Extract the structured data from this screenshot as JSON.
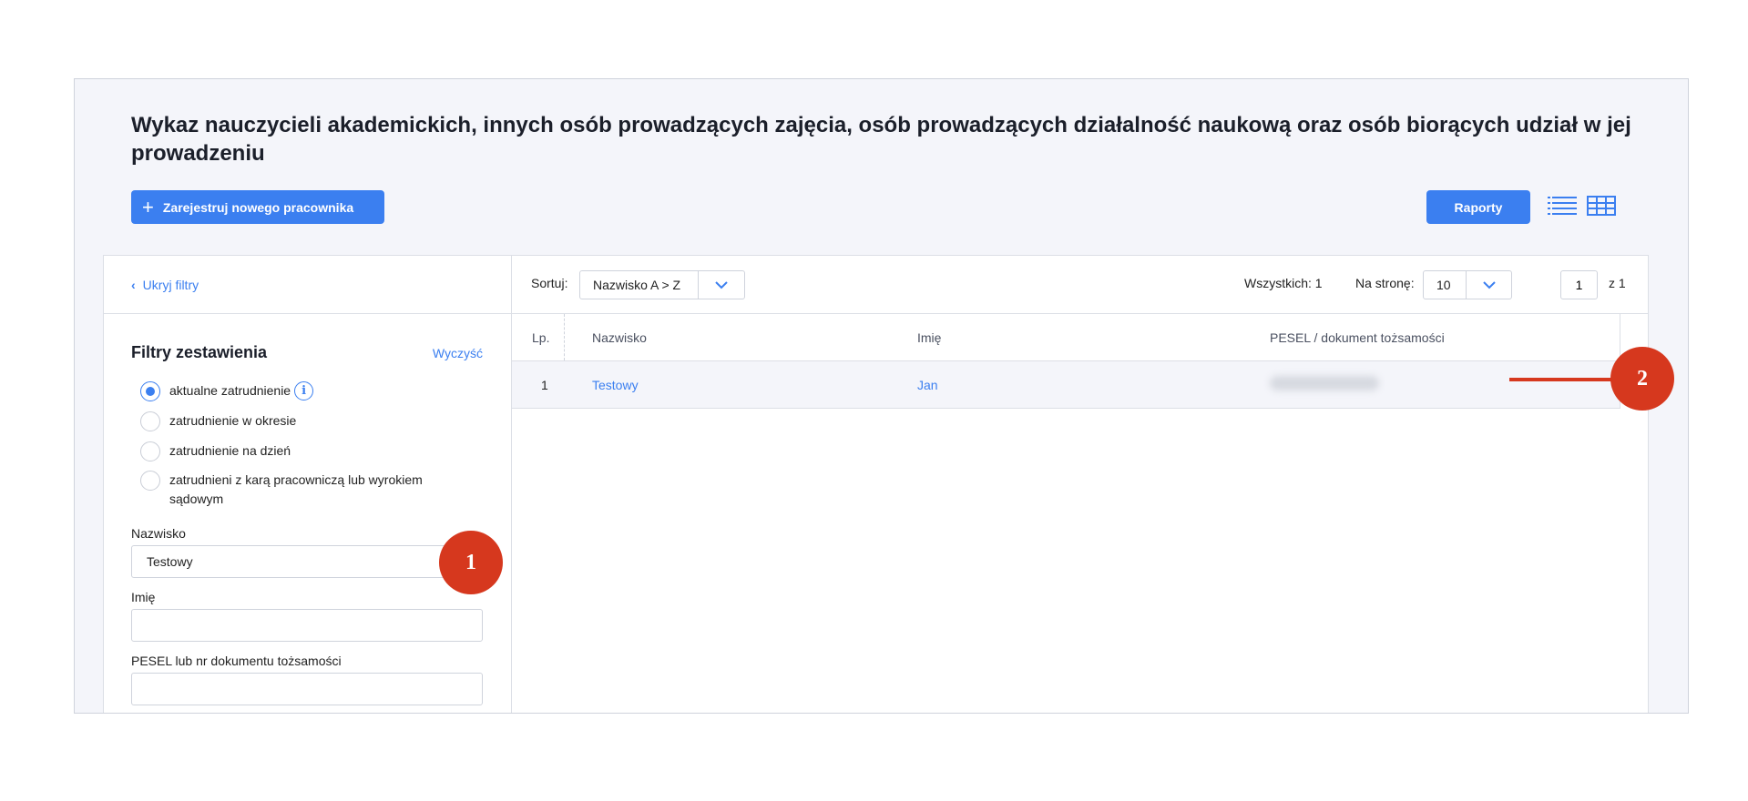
{
  "header": {
    "title": "Wykaz nauczycieli akademickich, innych osób prowadzących zajęcia, osób prowadzących działalność naukową oraz osób biorących udział w jej prowadzeniu",
    "register_button": "Zarejestruj nowego pracownika",
    "reports_button": "Raporty"
  },
  "sidebar": {
    "hide_filters": "Ukryj filtry",
    "filters_title": "Filtry zestawienia",
    "clear": "Wyczyść",
    "radios": [
      {
        "label": "aktualne zatrudnienie",
        "checked": true
      },
      {
        "label": "zatrudnienie w okresie",
        "checked": false
      },
      {
        "label": "zatrudnienie na dzień",
        "checked": false
      },
      {
        "label": "zatrudnieni z karą pracowniczą lub wyrokiem sądowym",
        "checked": false
      }
    ],
    "fields": {
      "surname_label": "Nazwisko",
      "surname_value": "Testowy",
      "firstname_label": "Imię",
      "firstname_value": "",
      "pesel_label": "PESEL lub nr dokumentu tożsamości",
      "pesel_value": ""
    }
  },
  "toolbar": {
    "sort_label": "Sortuj:",
    "sort_value": "Nazwisko A > Z",
    "total": "Wszystkich: 1",
    "per_page_label": "Na stronę:",
    "per_page_value": "10",
    "page_current": "1",
    "page_of": "z  1"
  },
  "table": {
    "headers": {
      "lp": "Lp.",
      "surname": "Nazwisko",
      "firstname": "Imię",
      "pesel": "PESEL / dokument tożsamości"
    },
    "rows": [
      {
        "lp": "1",
        "surname": "Testowy",
        "firstname": "Jan"
      }
    ]
  },
  "annotations": {
    "badge1": "1",
    "badge2": "2"
  },
  "colors": {
    "accent": "#3b7ff0",
    "callout": "#d6381e"
  }
}
